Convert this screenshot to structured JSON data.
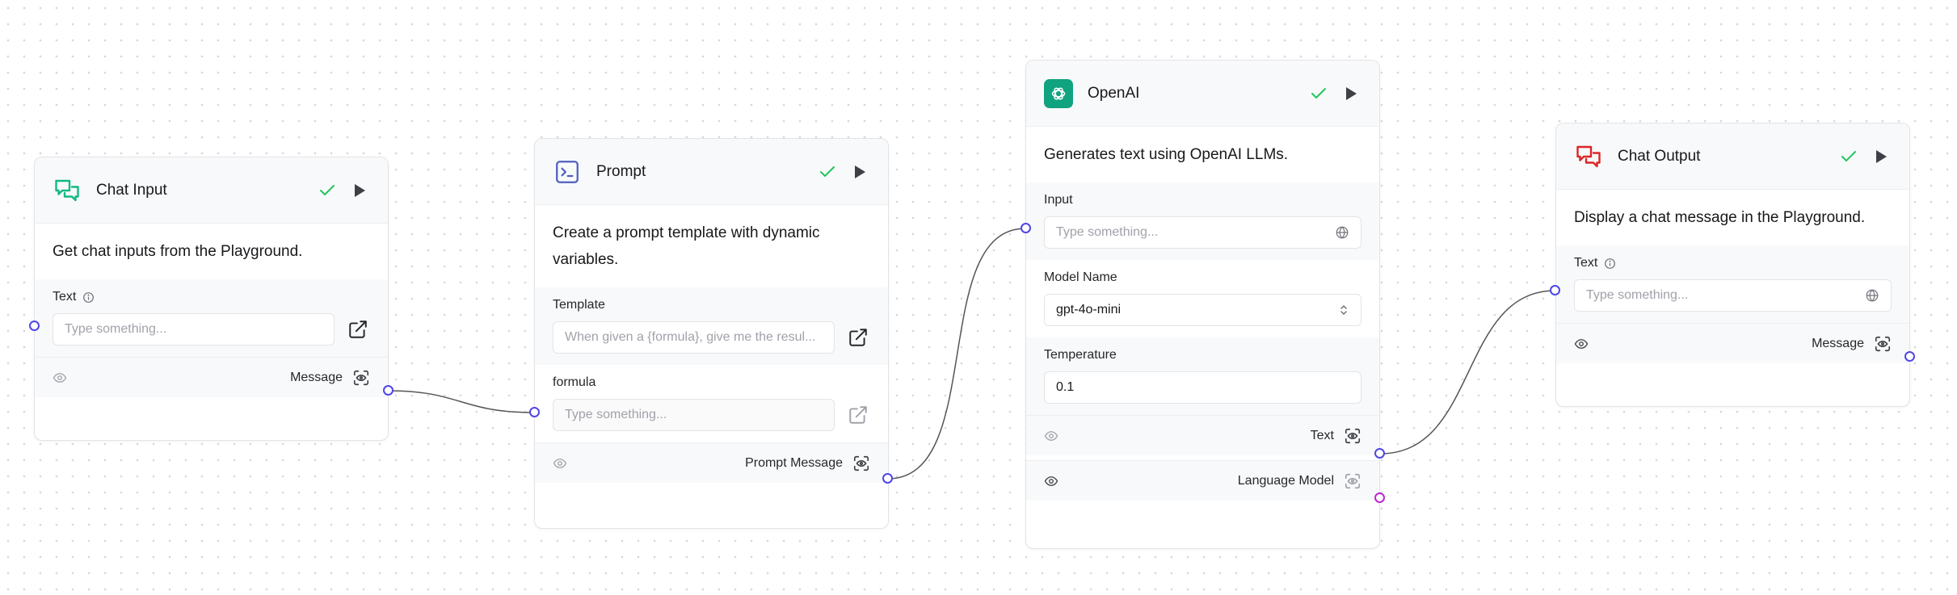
{
  "nodes": {
    "chat_input": {
      "title": "Chat Input",
      "description": "Get chat inputs from the Playground.",
      "fields": {
        "text_label": "Text",
        "text_placeholder": "Type something..."
      },
      "output": "Message",
      "icon": "chat-bubbles-icon",
      "accent": "#10b981"
    },
    "prompt": {
      "title": "Prompt",
      "description": "Create a prompt template with dynamic variables.",
      "fields": {
        "template_label": "Template",
        "template_placeholder": "When given a {formula}, give me the resul...",
        "formula_label": "formula",
        "formula_placeholder": "Type something..."
      },
      "output": "Prompt Message",
      "icon": "terminal-icon",
      "accent": "#4f5fbf"
    },
    "openai": {
      "title": "OpenAI",
      "description": "Generates text using OpenAI LLMs.",
      "fields": {
        "input_label": "Input",
        "input_placeholder": "Type something...",
        "model_label": "Model Name",
        "model_value": "gpt-4o-mini",
        "temperature_label": "Temperature",
        "temperature_value": "0.1"
      },
      "outputs": {
        "text": "Text",
        "language_model": "Language Model"
      },
      "icon": "openai-logo-icon",
      "accent": "#10a37f"
    },
    "chat_output": {
      "title": "Chat Output",
      "description": "Display a chat message in the Playground.",
      "fields": {
        "text_label": "Text",
        "text_placeholder": "Type something..."
      },
      "output": "Message",
      "icon": "chat-bubbles-icon",
      "accent": "#dc2626"
    }
  },
  "colors": {
    "success_check": "#22c55e",
    "handle_blue": "#4f46e5",
    "handle_purple": "#c026d3",
    "edge": "#555555"
  }
}
